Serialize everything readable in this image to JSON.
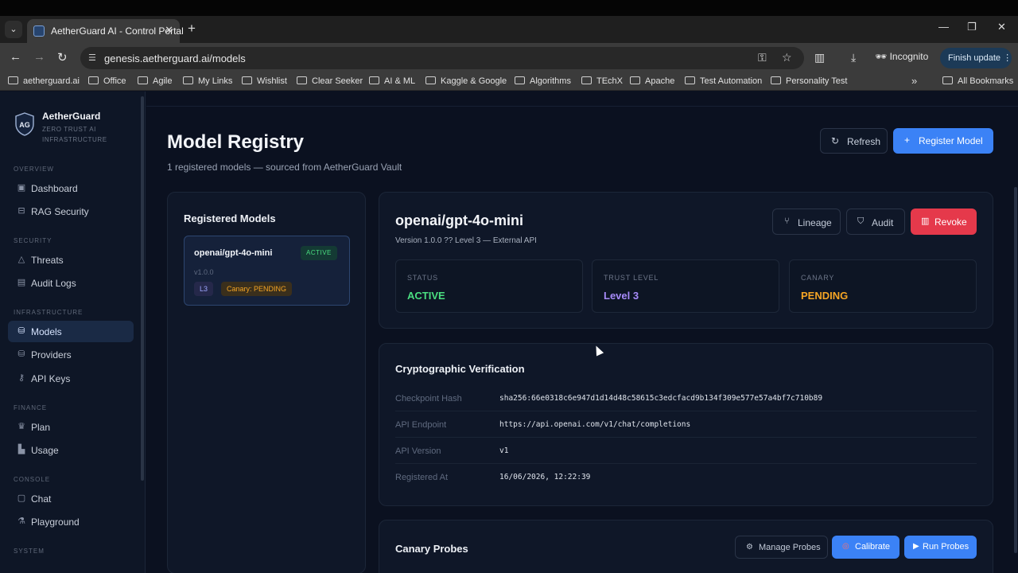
{
  "browser": {
    "tab_title": "AetherGuard AI - Control Portal",
    "new_tab": "+",
    "url": "genesis.aetherguard.ai/models",
    "incognito_label": "Incognito",
    "finish_update_label": "Finish update",
    "bookmarks": [
      "aetherguard.ai",
      "Office",
      "Agile",
      "My Links",
      "Wishlist",
      "Clear Seeker",
      "AI & ML",
      "Kaggle & Google",
      "Algorithms",
      "TEchX",
      "Apache",
      "Test Automation",
      "Personality Test"
    ],
    "more_bookmarks": "»",
    "all_bookmarks": "All Bookmarks"
  },
  "sidebar": {
    "brand": "AetherGuard",
    "logo_text": "AG",
    "tagline": "ZERO TRUST AI INFRASTRUCTURE",
    "sections": {
      "overview": "OVERVIEW",
      "security": "SECURITY",
      "infrastructure": "INFRASTRUCTURE",
      "finance": "FINANCE",
      "console": "CONSOLE",
      "system": "SYSTEM"
    },
    "items": {
      "dashboard": "Dashboard",
      "rag_security": "RAG Security",
      "threats": "Threats",
      "audit_logs": "Audit Logs",
      "models": "Models",
      "providers": "Providers",
      "api_keys": "API Keys",
      "plan": "Plan",
      "usage": "Usage",
      "chat": "Chat",
      "playground": "Playground"
    }
  },
  "header": {
    "title": "Model Registry",
    "subtitle": "1 registered models — sourced from AetherGuard Vault",
    "refresh_label": "Refresh",
    "register_label": "Register Model"
  },
  "registered_models": {
    "title": "Registered Models",
    "items": [
      {
        "name": "openai/gpt-4o-mini",
        "status": "ACTIVE",
        "version": "v1.0.0",
        "level": "L3",
        "canary": "Canary: PENDING"
      }
    ]
  },
  "detail": {
    "name": "openai/gpt-4o-mini",
    "subtitle": "Version 1.0.0 ?? Level 3 — External API",
    "lineage_label": "Lineage",
    "audit_label": "Audit",
    "revoke_label": "Revoke",
    "stats": {
      "status_label": "STATUS",
      "status_value": "ACTIVE",
      "trust_label": "TRUST LEVEL",
      "trust_value": "Level 3",
      "canary_label": "CANARY",
      "canary_value": "PENDING"
    }
  },
  "crypto": {
    "title": "Cryptographic Verification",
    "rows": [
      {
        "key": "Checkpoint Hash",
        "value": "sha256:66e0318c6e947d1d14d48c58615c3edcfacd9b134f309e577e57a4bf7c710b89"
      },
      {
        "key": "API Endpoint",
        "value": "https://api.openai.com/v1/chat/completions"
      },
      {
        "key": "API Version",
        "value": "v1"
      },
      {
        "key": "Registered At",
        "value": "16/06/2026, 12:22:39"
      }
    ]
  },
  "canary": {
    "title": "Canary Probes",
    "manage_label": "Manage Probes",
    "calibrate_label": "Calibrate",
    "run_label": "Run Probes"
  },
  "colors": {
    "accent": "#3b82f6",
    "active_green": "#4ade80",
    "trust_purple": "#a78bfa",
    "pending_amber": "#f5a524",
    "revoke_red": "#e5394b"
  }
}
